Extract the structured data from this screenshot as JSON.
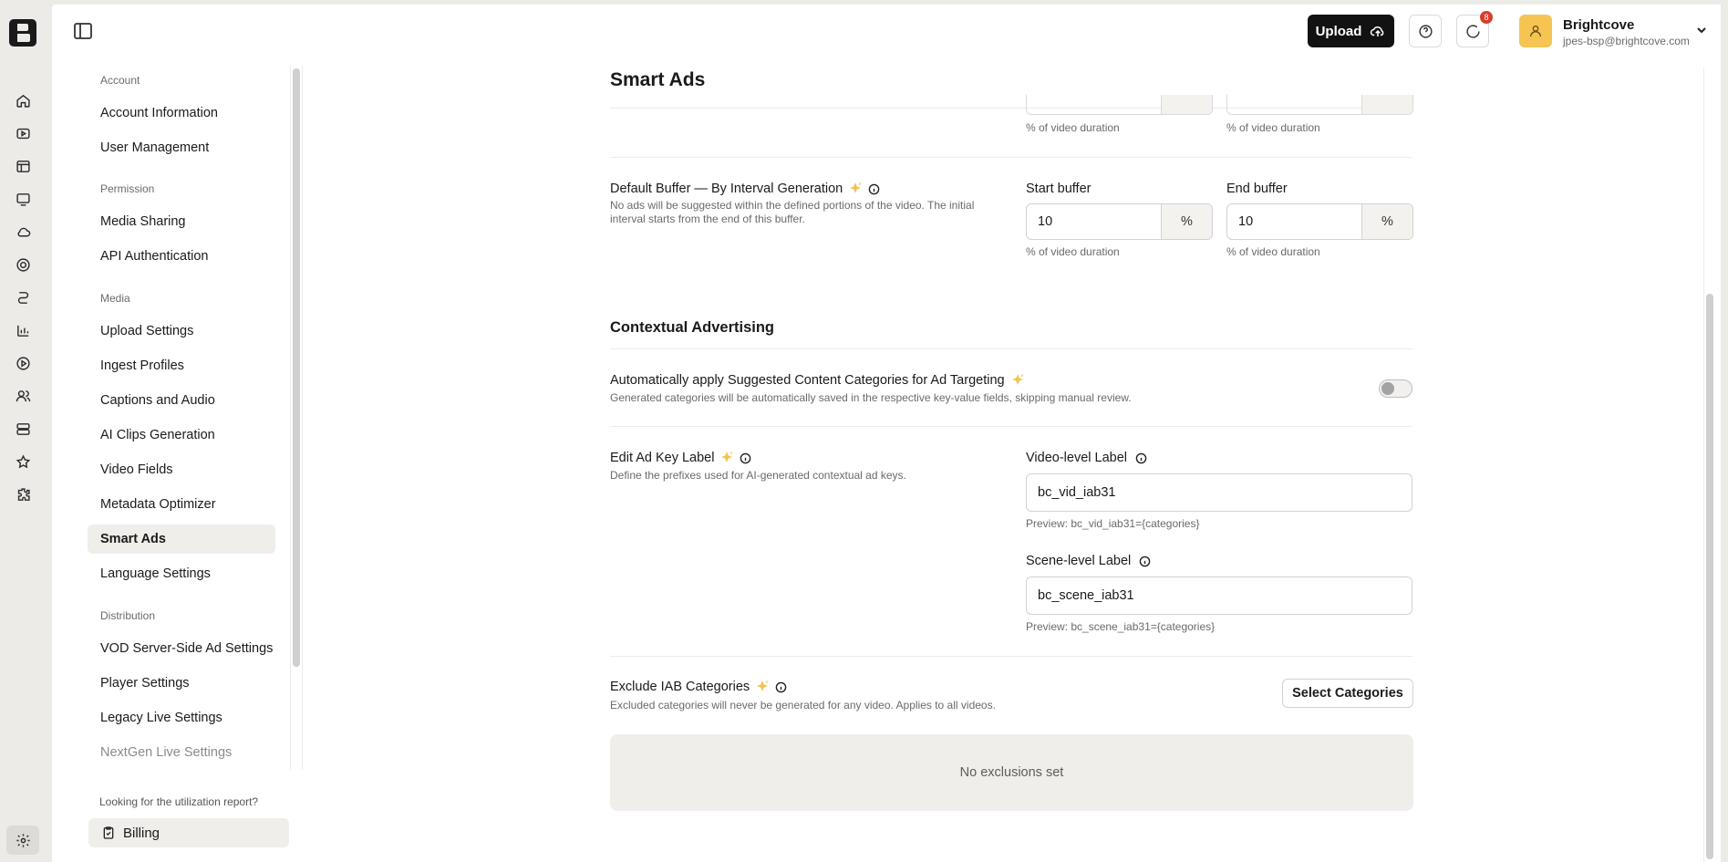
{
  "header": {
    "upload_label": "Upload",
    "notification_count": "8",
    "account_name": "Brightcove",
    "account_email": "jpes-bsp@brightcove.com"
  },
  "nav": {
    "sections": [
      {
        "label": "Account",
        "items": [
          "Account Information",
          "User Management"
        ]
      },
      {
        "label": "Permission",
        "items": [
          "Media Sharing",
          "API Authentication"
        ]
      },
      {
        "label": "Media",
        "items": [
          "Upload Settings",
          "Ingest Profiles",
          "Captions and Audio",
          "AI Clips Generation",
          "Video Fields",
          "Metadata Optimizer",
          "Smart Ads",
          "Language Settings"
        ]
      },
      {
        "label": "Distribution",
        "items": [
          "VOD Server-Side Ad Settings",
          "Player Settings",
          "Legacy Live Settings",
          "NextGen Live Settings"
        ]
      }
    ],
    "active_item": "Smart Ads",
    "utilization_question": "Looking for the utilization report?",
    "billing_label": "Billing"
  },
  "page": {
    "title": "Smart Ads",
    "top_hint_left": "% of video duration",
    "top_hint_right": "% of video duration",
    "buffer": {
      "label": "Default Buffer — By Interval Generation",
      "description": "No ads will be suggested within the defined portions of the video. The initial interval starts from the end of this buffer.",
      "start_label": "Start buffer",
      "start_value": "10",
      "start_unit": "%",
      "start_hint": "% of video duration",
      "end_label": "End buffer",
      "end_value": "10",
      "end_unit": "%",
      "end_hint": "% of video duration"
    },
    "contextual": {
      "title": "Contextual Advertising",
      "auto_label": "Automatically apply Suggested Content Categories for Ad Targeting",
      "auto_description": "Generated categories will be automatically saved in the respective key-value fields, skipping manual review.",
      "auto_enabled": false,
      "key_label": "Edit Ad Key Label",
      "key_description": "Define the prefixes used for AI-generated contextual ad keys.",
      "video_level_label": "Video-level Label",
      "video_level_value": "bc_vid_iab31",
      "video_level_preview": "Preview: bc_vid_iab31={categories}",
      "scene_level_label": "Scene-level Label",
      "scene_level_value": "bc_scene_iab31",
      "scene_level_preview": "Preview: bc_scene_iab31={categories}",
      "exclude_label": "Exclude IAB Categories",
      "exclude_description": "Excluded categories will never be generated for any video. Applies to all videos.",
      "select_button": "Select Categories",
      "empty_text": "No exclusions set"
    }
  },
  "colors": {
    "background": "#ecebe8",
    "panel": "#ffffff",
    "primary_button": "#121212",
    "avatar": "#f6c453",
    "badge": "#d93c2c",
    "sparkle": "#f2c24b"
  }
}
